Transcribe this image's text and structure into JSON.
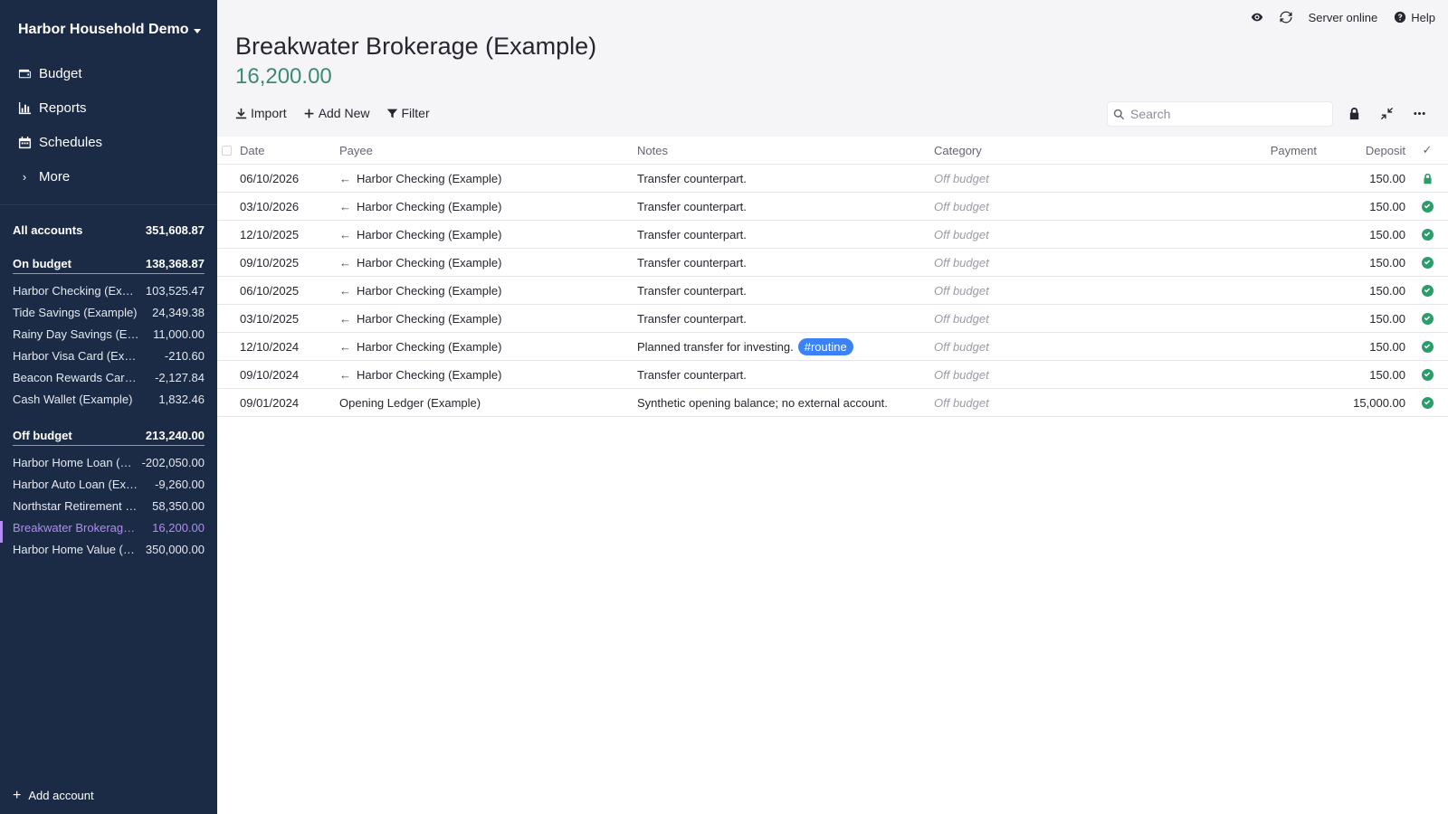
{
  "sidebar": {
    "budget_name": "Harbor Household Demo",
    "nav": [
      {
        "label": "Budget",
        "icon": "wallet-icon"
      },
      {
        "label": "Reports",
        "icon": "chart-icon"
      },
      {
        "label": "Schedules",
        "icon": "calendar-icon"
      },
      {
        "label": "More",
        "icon": "chevron-right-icon"
      }
    ],
    "all_accounts": {
      "label": "All accounts",
      "balance": "351,608.87"
    },
    "on_budget": {
      "label": "On budget",
      "balance": "138,368.87",
      "accounts": [
        {
          "name": "Harbor Checking (Example)",
          "balance": "103,525.47"
        },
        {
          "name": "Tide Savings (Example)",
          "balance": "24,349.38"
        },
        {
          "name": "Rainy Day Savings (Example)",
          "balance": "11,000.00"
        },
        {
          "name": "Harbor Visa Card (Example)",
          "balance": "-210.60"
        },
        {
          "name": "Beacon Rewards Card (Example)",
          "balance": "-2,127.84"
        },
        {
          "name": "Cash Wallet (Example)",
          "balance": "1,832.46"
        }
      ]
    },
    "off_budget": {
      "label": "Off budget",
      "balance": "213,240.00",
      "accounts": [
        {
          "name": "Harbor Home Loan (Example)",
          "balance": "-202,050.00"
        },
        {
          "name": "Harbor Auto Loan (Example)",
          "balance": "-9,260.00"
        },
        {
          "name": "Northstar Retirement (Example)",
          "balance": "58,350.00"
        },
        {
          "name": "Breakwater Brokerage (Example)",
          "balance": "16,200.00"
        },
        {
          "name": "Harbor Home Value (Example)",
          "balance": "350,000.00"
        }
      ]
    },
    "add_account": "Add account"
  },
  "topbar": {
    "server_status": "Server online",
    "help": "Help"
  },
  "account": {
    "title": "Breakwater Brokerage (Example)",
    "balance": "16,200.00"
  },
  "toolbar": {
    "import": "Import",
    "add_new": "Add New",
    "filter": "Filter",
    "search_placeholder": "Search"
  },
  "table": {
    "headers": {
      "date": "Date",
      "payee": "Payee",
      "notes": "Notes",
      "category": "Category",
      "payment": "Payment",
      "deposit": "Deposit",
      "cleared": "✓"
    },
    "rows": [
      {
        "date": "06/10/2026",
        "payee": "Harbor Checking (Example)",
        "transfer": true,
        "notes": "Transfer counterpart.",
        "tag": "",
        "category": "Off budget",
        "payment": "",
        "deposit": "150.00",
        "status": "locked"
      },
      {
        "date": "03/10/2026",
        "payee": "Harbor Checking (Example)",
        "transfer": true,
        "notes": "Transfer counterpart.",
        "tag": "",
        "category": "Off budget",
        "payment": "",
        "deposit": "150.00",
        "status": "cleared"
      },
      {
        "date": "12/10/2025",
        "payee": "Harbor Checking (Example)",
        "transfer": true,
        "notes": "Transfer counterpart.",
        "tag": "",
        "category": "Off budget",
        "payment": "",
        "deposit": "150.00",
        "status": "cleared"
      },
      {
        "date": "09/10/2025",
        "payee": "Harbor Checking (Example)",
        "transfer": true,
        "notes": "Transfer counterpart.",
        "tag": "",
        "category": "Off budget",
        "payment": "",
        "deposit": "150.00",
        "status": "cleared"
      },
      {
        "date": "06/10/2025",
        "payee": "Harbor Checking (Example)",
        "transfer": true,
        "notes": "Transfer counterpart.",
        "tag": "",
        "category": "Off budget",
        "payment": "",
        "deposit": "150.00",
        "status": "cleared"
      },
      {
        "date": "03/10/2025",
        "payee": "Harbor Checking (Example)",
        "transfer": true,
        "notes": "Transfer counterpart.",
        "tag": "",
        "category": "Off budget",
        "payment": "",
        "deposit": "150.00",
        "status": "cleared"
      },
      {
        "date": "12/10/2024",
        "payee": "Harbor Checking (Example)",
        "transfer": true,
        "notes": "Planned transfer for investing.",
        "tag": "#routine",
        "category": "Off budget",
        "payment": "",
        "deposit": "150.00",
        "status": "cleared"
      },
      {
        "date": "09/10/2024",
        "payee": "Harbor Checking (Example)",
        "transfer": true,
        "notes": "Transfer counterpart.",
        "tag": "",
        "category": "Off budget",
        "payment": "",
        "deposit": "150.00",
        "status": "cleared"
      },
      {
        "date": "09/01/2024",
        "payee": "Opening Ledger (Example)",
        "transfer": false,
        "notes": "Synthetic opening balance; no external account.",
        "tag": "",
        "category": "Off budget",
        "payment": "",
        "deposit": "15,000.00",
        "status": "cleared"
      }
    ]
  },
  "colors": {
    "sidebar_bg": "#1b2a45",
    "active_account": "#b28cf0",
    "balance_green": "#3d8a74",
    "cleared_green": "#2a9d6b",
    "tag_blue": "#3b82f6"
  }
}
